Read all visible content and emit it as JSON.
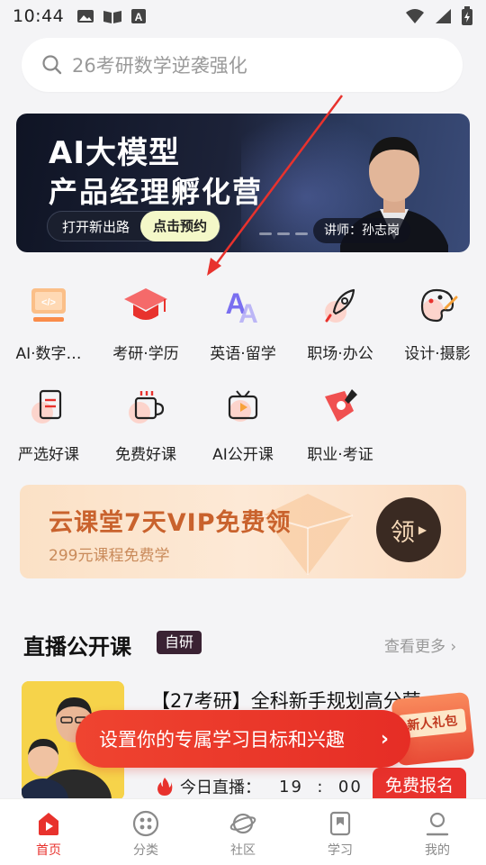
{
  "status": {
    "time": "10:44"
  },
  "search": {
    "placeholder": "26考研数学逆袭强化"
  },
  "banner": {
    "title1": "AI大模型",
    "title2": "产品经理孵化营",
    "cta_left": "打开新出路",
    "cta_right": "点击预约",
    "teacher": "讲师：孙志岗"
  },
  "categories": [
    {
      "label": "AI·数字…",
      "icon": "code-monitor-icon"
    },
    {
      "label": "考研·学历",
      "icon": "graduation-cap-icon"
    },
    {
      "label": "英语·留学",
      "icon": "letter-a-icon"
    },
    {
      "label": "职场·办公",
      "icon": "rocket-icon"
    },
    {
      "label": "设计·摄影",
      "icon": "palette-icon"
    },
    {
      "label": "严选好课",
      "icon": "document-icon"
    },
    {
      "label": "免费好课",
      "icon": "cup-icon"
    },
    {
      "label": "AI公开课",
      "icon": "tv-play-icon"
    },
    {
      "label": "职业·考证",
      "icon": "badge-pen-icon"
    }
  ],
  "vip": {
    "title": "云课堂7天VIP免费领",
    "subtitle": "299元课程免费学",
    "button": "领"
  },
  "live": {
    "section_title": "直播公开课",
    "badge": "自研",
    "more": "查看更多",
    "card": {
      "title": "【27考研】全科新手规划高分营",
      "live_label": "今日直播：",
      "time_h": "19",
      "time_sep": ":",
      "time_m": "00",
      "register": "免费报名"
    }
  },
  "goal_prompt": "设置你的专属学习目标和兴趣",
  "gift": {
    "label": "新人礼包"
  },
  "tabs": [
    {
      "label": "首页",
      "icon": "home-play-icon",
      "active": true
    },
    {
      "label": "分类",
      "icon": "grid-dots-icon",
      "active": false
    },
    {
      "label": "社区",
      "icon": "planet-icon",
      "active": false
    },
    {
      "label": "学习",
      "icon": "bookmark-icon",
      "active": false
    },
    {
      "label": "我的",
      "icon": "user-icon",
      "active": false
    }
  ],
  "colors": {
    "accent": "#e8322d",
    "vip_text": "#c9622d",
    "banner_bg": "#1c2238"
  }
}
